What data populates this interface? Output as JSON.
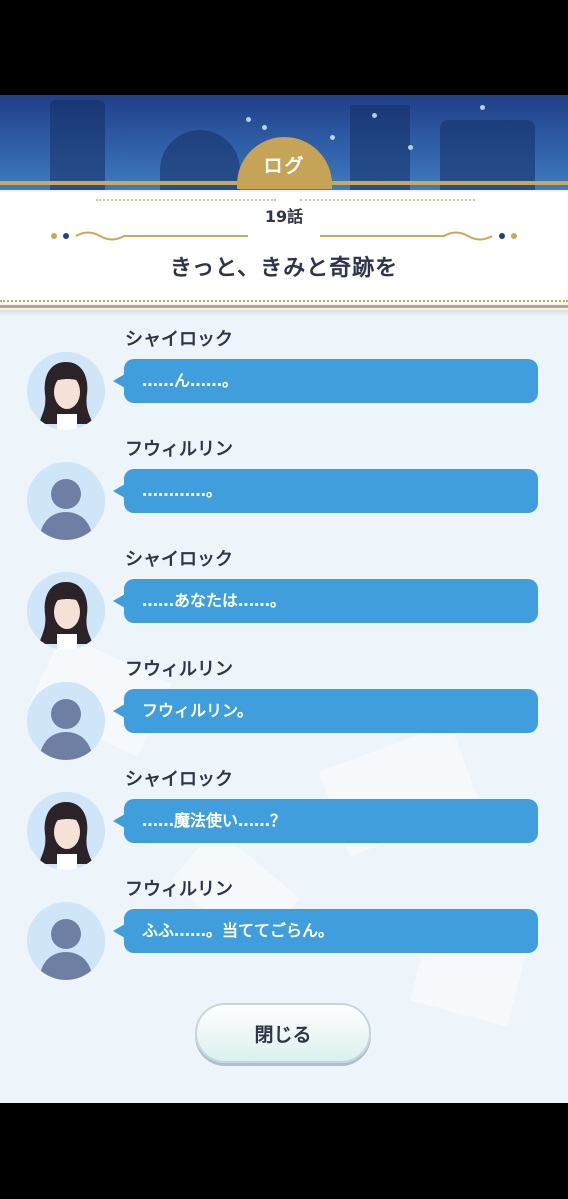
{
  "header": {
    "tab_label": "ログ",
    "episode": "19話",
    "title": "きっと、きみと奇跡を"
  },
  "messages": [
    {
      "speaker": "シャイロック",
      "text": "……ん……。",
      "avatar": "shylock-portrait"
    },
    {
      "speaker": "フウィルリン",
      "text": "…………。",
      "avatar": "silhouette-avatar"
    },
    {
      "speaker": "シャイロック",
      "text": "……あなたは……。",
      "avatar": "shylock-portrait"
    },
    {
      "speaker": "フウィルリン",
      "text": "フウィルリン。",
      "avatar": "silhouette-avatar"
    },
    {
      "speaker": "シャイロック",
      "text": "……魔法使い……？",
      "avatar": "shylock-portrait"
    },
    {
      "speaker": "フウィルリン",
      "text": "ふふ……。当ててごらん。",
      "avatar": "silhouette-avatar"
    }
  ],
  "footer": {
    "close_label": "閉じる"
  },
  "colors": {
    "gold": "#c9a85b",
    "bubble": "#3f9edb",
    "text": "#2e3547"
  }
}
